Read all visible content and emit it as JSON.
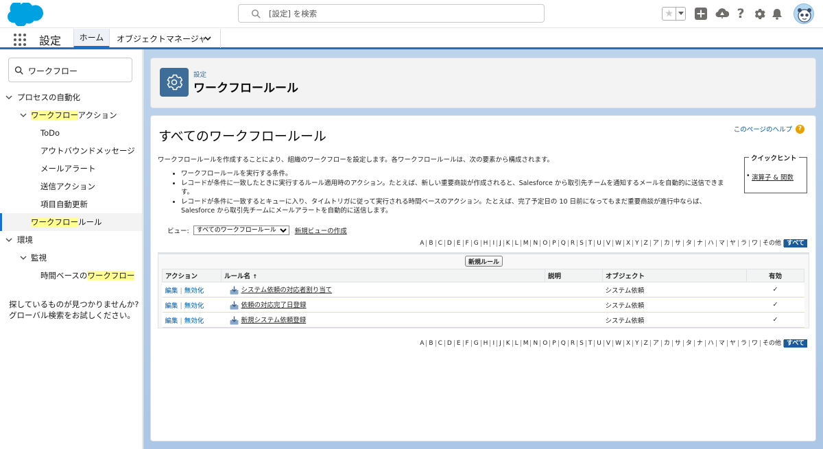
{
  "header": {
    "search_placeholder": "[設定] を検索"
  },
  "nav": {
    "app_name": "設定",
    "tab_home": "ホーム",
    "tab_object_manager": "オブジェクトマネージャ"
  },
  "sidebar": {
    "quickfind_value": "ワークフロー",
    "process_automation": "プロセスの自動化",
    "wf_actions_hl": "ワークフロー",
    "wf_actions_rest": "アクション",
    "todo": "ToDo",
    "outbound": "アウトバウンドメッセージ",
    "email_alert": "メールアラート",
    "send_action": "送信アクション",
    "field_update": "項目自動更新",
    "wf_rules_hl": "ワークフロー",
    "wf_rules_rest": "ルール",
    "environment": "環境",
    "monitoring": "監視",
    "time_based_prefix": "時間ベースの",
    "time_based_hl": "ワークフロー",
    "help_text": "探しているものが見つかりませんか? グローバル検索をお試しください。"
  },
  "page_header": {
    "breadcrumb": "設定",
    "title": "ワークフロールール"
  },
  "content": {
    "title": "すべてのワークフロールール",
    "help_link": "このページのヘルプ",
    "description": "ワークフロールールを作成することにより、組織のワークフローを設定します。各ワークフロールールは、次の要素から構成されます。",
    "bullets": [
      "ワークフロールールを実行する条件。",
      "レコードが条件に一致したときに実行するルール適用時のアクション。たとえば、新しい重要商談が作成されると、Salesforce から取引先チームを通知するメールを自動的に送信できます。",
      "レコードが条件に一致するとキューに入り、タイムトリガに従って実行される時間ベースのアクション。たとえば、完了予定日の 10 日前になってもまだ重要商談が進行中ならば、Salesforce から取引先チームにメールアラートを自動的に送信します。"
    ],
    "quick_hint_title": "クイックヒント",
    "quick_hint_link": "演算子 & 関数",
    "view_label": "ビュー:",
    "view_selected": "すべてのワークフロールール",
    "new_view": "新規ビューの作成",
    "alphabet": [
      "A",
      "B",
      "C",
      "D",
      "E",
      "F",
      "G",
      "H",
      "I",
      "J",
      "K",
      "L",
      "M",
      "N",
      "O",
      "P",
      "Q",
      "R",
      "S",
      "T",
      "U",
      "V",
      "W",
      "X",
      "Y",
      "Z",
      "ア",
      "カ",
      "サ",
      "タ",
      "ナ",
      "ハ",
      "マ",
      "ヤ",
      "ラ",
      "ワ",
      "その他",
      "すべて"
    ],
    "new_rule_button": "新規ルール",
    "columns": {
      "action": "アクション",
      "rule_name": "ルール名",
      "sort_arrow": "↑",
      "description": "説明",
      "object": "オブジェクト",
      "active": "有効"
    },
    "rows": [
      {
        "edit": "編集",
        "deactivate": "無効化",
        "name": "システム依頼の対応者割り当て",
        "description": "",
        "object": "システム依頼",
        "active": "✓"
      },
      {
        "edit": "編集",
        "deactivate": "無効化",
        "name": "依頼の対応完了日登録",
        "description": "",
        "object": "システム依頼",
        "active": "✓"
      },
      {
        "edit": "編集",
        "deactivate": "無効化",
        "name": "新規システム依頼登録",
        "description": "",
        "object": "システム依頼",
        "active": "✓"
      }
    ]
  }
}
